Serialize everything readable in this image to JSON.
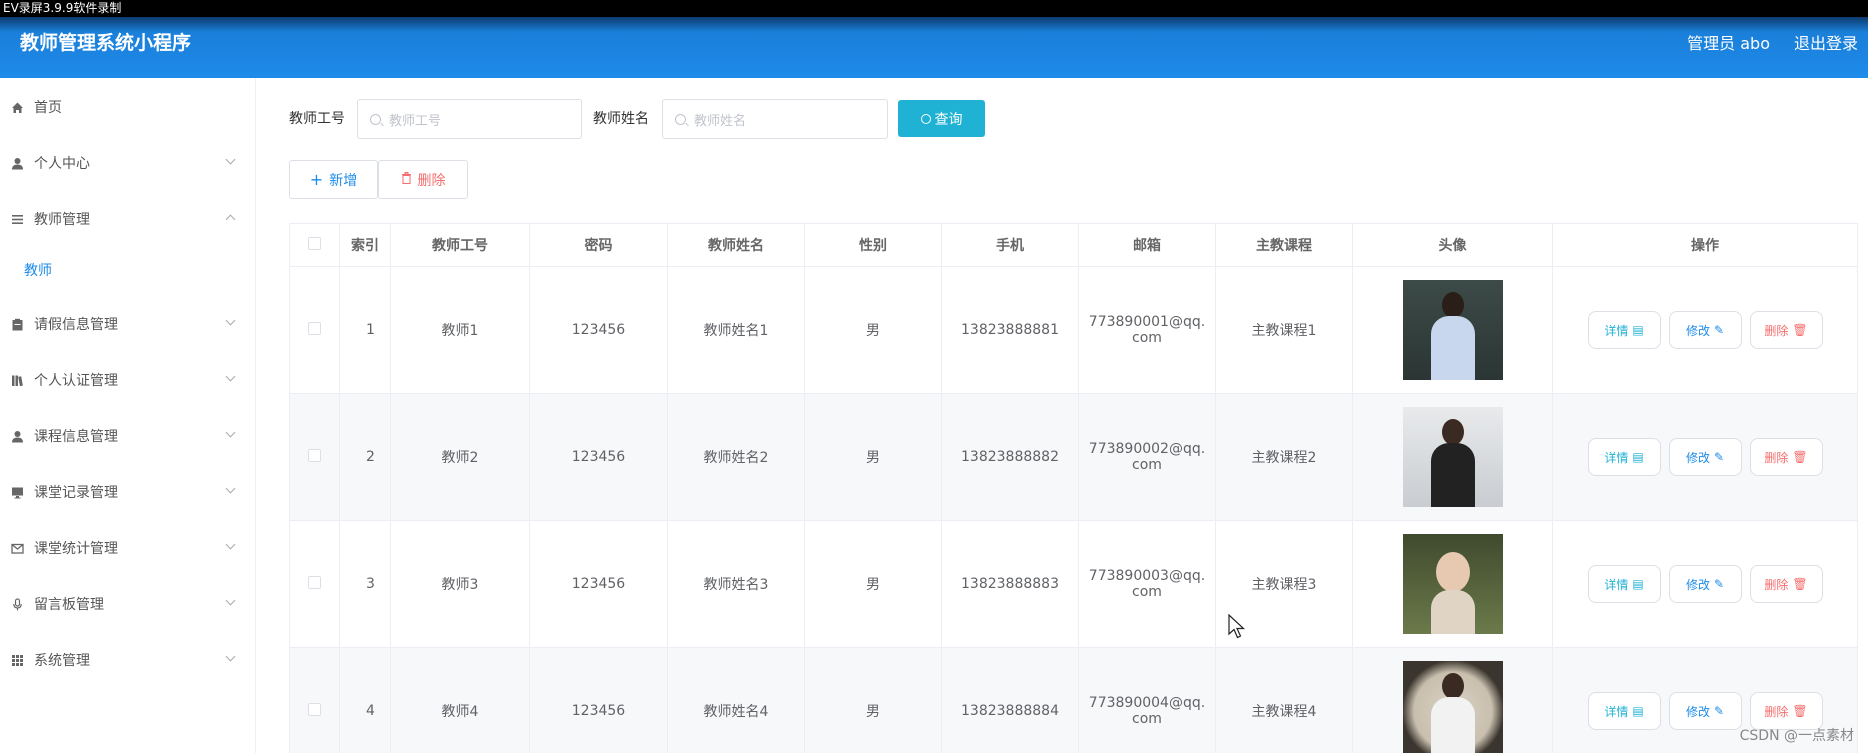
{
  "recording_bar": "EV录屏3.9.9软件录制",
  "header": {
    "title": "教师管理系统小程序",
    "user_label": "管理员 abo",
    "logout_label": "退出登录"
  },
  "sidebar": {
    "items": [
      {
        "label": "首页",
        "icon": "home-icon"
      },
      {
        "label": "个人中心",
        "icon": "user-icon"
      },
      {
        "label": "教师管理",
        "icon": "list-icon"
      },
      {
        "label": "教师",
        "icon": ""
      },
      {
        "label": "请假信息管理",
        "icon": "clipboard-icon"
      },
      {
        "label": "个人认证管理",
        "icon": "books-icon"
      },
      {
        "label": "课程信息管理",
        "icon": "user-icon"
      },
      {
        "label": "课堂记录管理",
        "icon": "monitor-icon"
      },
      {
        "label": "课堂统计管理",
        "icon": "mail-icon"
      },
      {
        "label": "留言板管理",
        "icon": "microphone-icon"
      },
      {
        "label": "系统管理",
        "icon": "grid-icon"
      }
    ]
  },
  "search": {
    "teacher_no_label": "教师工号",
    "teacher_no_placeholder": "教师工号",
    "teacher_name_label": "教师姓名",
    "teacher_name_placeholder": "教师姓名",
    "query_label": "查询"
  },
  "toolbar": {
    "add_label": "新增",
    "delete_label": "删除"
  },
  "table": {
    "headers": [
      "索引",
      "教师工号",
      "密码",
      "教师姓名",
      "性别",
      "手机",
      "邮箱",
      "主教课程",
      "头像",
      "操作"
    ],
    "rows": [
      {
        "index": "1",
        "no": "教师1",
        "password": "123456",
        "name": "教师姓名1",
        "gender": "男",
        "phone": "13823888881",
        "email_a": "773890001@qq.",
        "email_b": "com",
        "course": "主教课程1"
      },
      {
        "index": "2",
        "no": "教师2",
        "password": "123456",
        "name": "教师姓名2",
        "gender": "男",
        "phone": "13823888882",
        "email_a": "773890002@qq.",
        "email_b": "com",
        "course": "主教课程2"
      },
      {
        "index": "3",
        "no": "教师3",
        "password": "123456",
        "name": "教师姓名3",
        "gender": "男",
        "phone": "13823888883",
        "email_a": "773890003@qq.",
        "email_b": "com",
        "course": "主教课程3"
      },
      {
        "index": "4",
        "no": "教师4",
        "password": "123456",
        "name": "教师姓名4",
        "gender": "男",
        "phone": "13823888884",
        "email_a": "773890004@qq.",
        "email_b": "com",
        "course": "主教课程4"
      }
    ],
    "actions": {
      "detail": "详情",
      "edit": "修改",
      "remove": "删除"
    }
  },
  "watermark": "CSDN @一点素材",
  "colors": {
    "header": "#1e8bea",
    "query": "#20b2d4",
    "danger": "#f56c6c",
    "primary": "#1e8bea"
  }
}
